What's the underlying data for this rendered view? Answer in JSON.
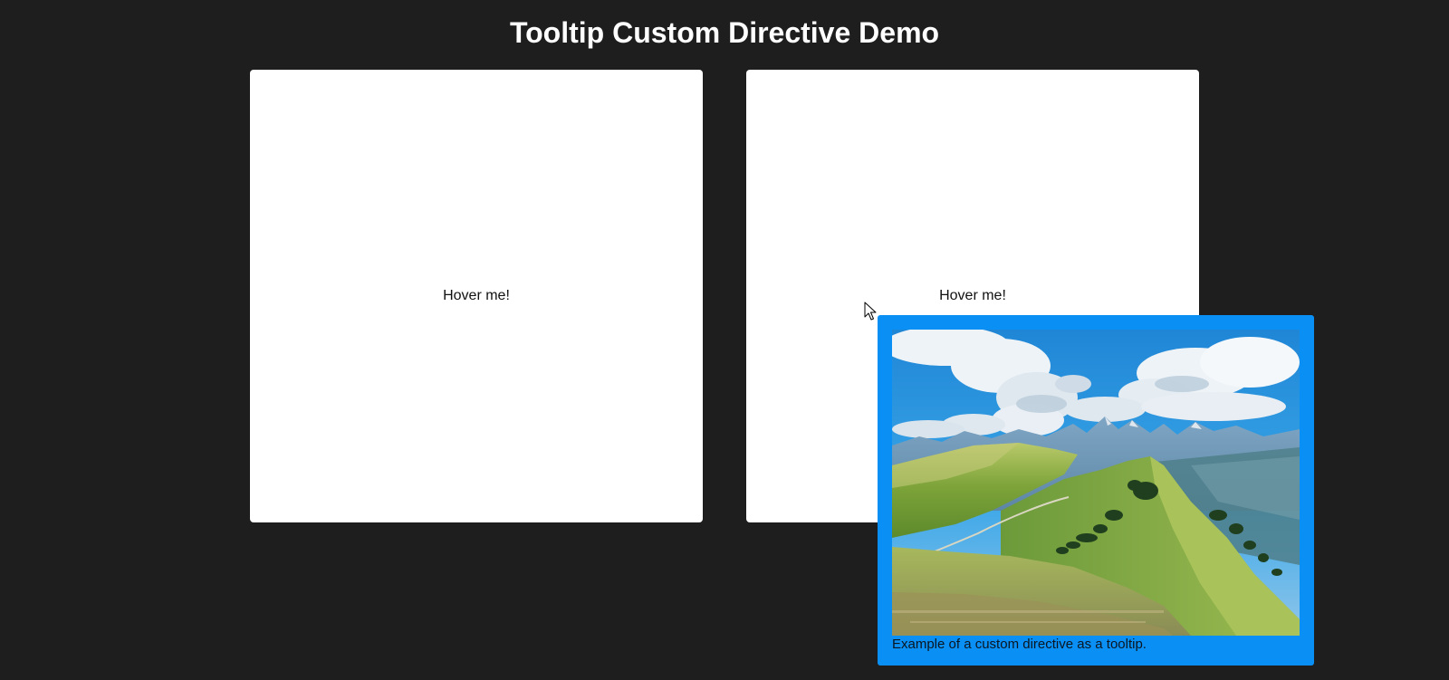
{
  "page": {
    "title": "Tooltip Custom Directive Demo"
  },
  "cards": [
    {
      "label": "Hover me!"
    },
    {
      "label": "Hover me!"
    }
  ],
  "tooltip": {
    "caption": "Example of a custom directive as a tooltip.",
    "image_subject": "alpine-mountain-ridge-photo"
  },
  "colors": {
    "background": "#1e1e1e",
    "card": "#ffffff",
    "tooltip": "#0a8ff5"
  }
}
